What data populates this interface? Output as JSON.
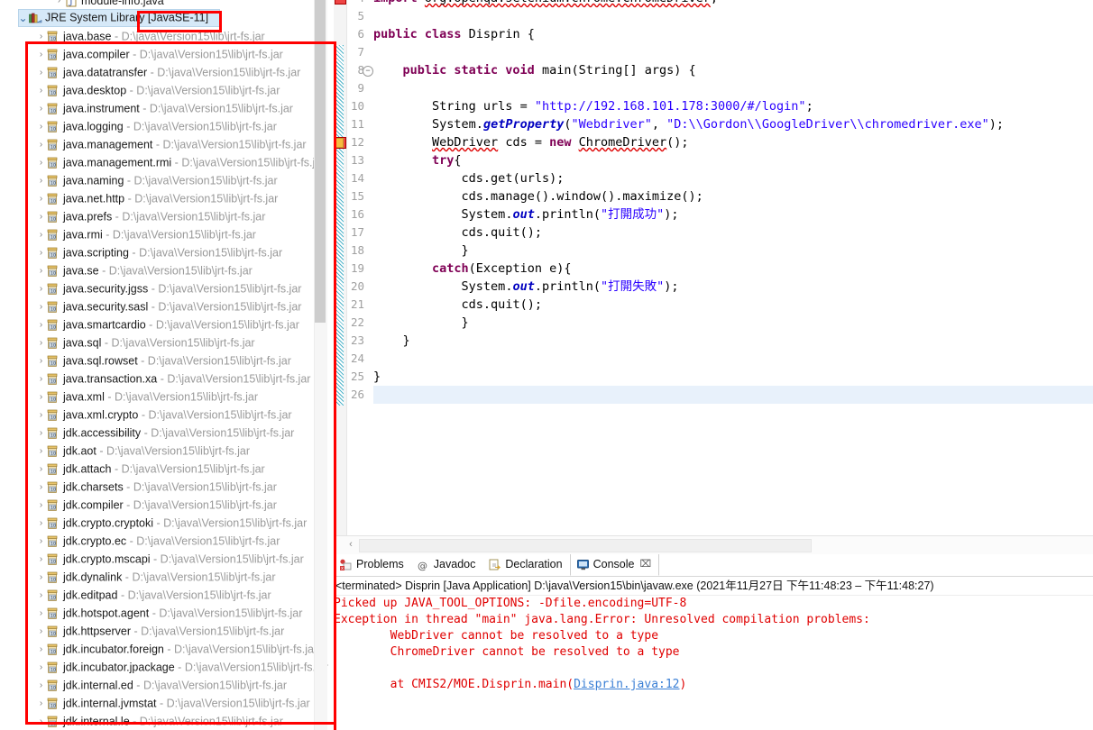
{
  "app": {
    "name": "Eclipse IDE",
    "accent_red": "#ff0000",
    "selection_blue": "#d6e9f8"
  },
  "sidebar": {
    "name": "package-explorer",
    "partial_top_item": {
      "label": "module-info.java",
      "icon": "java-file-icon",
      "arrow": "›"
    },
    "jre_node": {
      "label": "JRE System Library",
      "bracket": "[JavaSE-11]",
      "icon": "library-icon",
      "arrow": "⌄",
      "selected": true
    },
    "path_suffix": "D:\\java\\Version15\\lib\\jrt-fs.jar",
    "separator": "-",
    "modules": [
      "java.base",
      "java.compiler",
      "java.datatransfer",
      "java.desktop",
      "java.instrument",
      "java.logging",
      "java.management",
      "java.management.rmi",
      "java.naming",
      "java.net.http",
      "java.prefs",
      "java.rmi",
      "java.scripting",
      "java.se",
      "java.security.jgss",
      "java.security.sasl",
      "java.smartcardio",
      "java.sql",
      "java.sql.rowset",
      "java.transaction.xa",
      "java.xml",
      "java.xml.crypto",
      "jdk.accessibility",
      "jdk.aot",
      "jdk.attach",
      "jdk.charsets",
      "jdk.compiler",
      "jdk.crypto.cryptoki",
      "jdk.crypto.ec",
      "jdk.crypto.mscapi",
      "jdk.dynalink",
      "jdk.editpad",
      "jdk.hotspot.agent",
      "jdk.httpserver",
      "jdk.incubator.foreign",
      "jdk.incubator.jpackage",
      "jdk.internal.ed",
      "jdk.internal.jvmstat",
      "jdk.internal.le"
    ]
  },
  "editor": {
    "name": "java-source-editor",
    "first_visible_line": 4,
    "current_line": 26,
    "lines": [
      {
        "n": 4,
        "tokens": [
          {
            "t": "import ",
            "c": "kw"
          },
          {
            "t": "org.openqa.selenium.chrome.ChromeDriver",
            "c": "squig"
          },
          {
            "t": ";",
            "c": "plain"
          }
        ],
        "indent": 0,
        "marker": "error"
      },
      {
        "n": 5,
        "tokens": [],
        "indent": 0
      },
      {
        "n": 6,
        "tokens": [
          {
            "t": "public class ",
            "c": "kw"
          },
          {
            "t": "Disprin {",
            "c": "plain"
          }
        ],
        "indent": 0
      },
      {
        "n": 7,
        "tokens": [],
        "indent": 0
      },
      {
        "n": 8,
        "tokens": [
          {
            "t": "public static void ",
            "c": "kw"
          },
          {
            "t": "main(String[] args) {",
            "c": "plain"
          }
        ],
        "indent": 1,
        "fold": true
      },
      {
        "n": 9,
        "tokens": [],
        "indent": 0
      },
      {
        "n": 10,
        "tokens": [
          {
            "t": "String urls = ",
            "c": "plain"
          },
          {
            "t": "\"http://192.168.101.178:3000/#/login\"",
            "c": "str"
          },
          {
            "t": ";",
            "c": "plain"
          }
        ],
        "indent": 2
      },
      {
        "n": 11,
        "tokens": [
          {
            "t": "System.",
            "c": "plain"
          },
          {
            "t": "getProperty",
            "c": "ital"
          },
          {
            "t": "(",
            "c": "plain"
          },
          {
            "t": "\"Webdriver\"",
            "c": "str"
          },
          {
            "t": ", ",
            "c": "plain"
          },
          {
            "t": "\"D:\\\\Gordon\\\\GoogleDriver\\\\chromedriver.exe\"",
            "c": "str"
          },
          {
            "t": ");",
            "c": "plain"
          }
        ],
        "indent": 2
      },
      {
        "n": 12,
        "tokens": [
          {
            "t": "WebDriver",
            "c": "squig"
          },
          {
            "t": " cds = ",
            "c": "plain"
          },
          {
            "t": "new ",
            "c": "kw"
          },
          {
            "t": "ChromeDriver",
            "c": "squig"
          },
          {
            "t": "();",
            "c": "plain"
          }
        ],
        "indent": 2,
        "marker": "error"
      },
      {
        "n": 13,
        "tokens": [
          {
            "t": "try",
            "c": "kw"
          },
          {
            "t": "{",
            "c": "plain"
          }
        ],
        "indent": 2
      },
      {
        "n": 14,
        "tokens": [
          {
            "t": "cds.get(urls);",
            "c": "plain"
          }
        ],
        "indent": 3
      },
      {
        "n": 15,
        "tokens": [
          {
            "t": "cds.manage().window().maximize();",
            "c": "plain"
          }
        ],
        "indent": 3
      },
      {
        "n": 16,
        "tokens": [
          {
            "t": "System.",
            "c": "plain"
          },
          {
            "t": "out",
            "c": "ital"
          },
          {
            "t": ".println(",
            "c": "plain"
          },
          {
            "t": "\"打開成功\"",
            "c": "str"
          },
          {
            "t": ");",
            "c": "plain"
          }
        ],
        "indent": 3
      },
      {
        "n": 17,
        "tokens": [
          {
            "t": "cds.quit();",
            "c": "plain"
          }
        ],
        "indent": 3
      },
      {
        "n": 18,
        "tokens": [
          {
            "t": "}",
            "c": "plain"
          }
        ],
        "indent": 3
      },
      {
        "n": 19,
        "tokens": [
          {
            "t": "catch",
            "c": "kw"
          },
          {
            "t": "(Exception e){",
            "c": "plain"
          }
        ],
        "indent": 2
      },
      {
        "n": 20,
        "tokens": [
          {
            "t": "System.",
            "c": "plain"
          },
          {
            "t": "out",
            "c": "ital"
          },
          {
            "t": ".println(",
            "c": "plain"
          },
          {
            "t": "\"打開失敗\"",
            "c": "str"
          },
          {
            "t": ");",
            "c": "plain"
          }
        ],
        "indent": 3
      },
      {
        "n": 21,
        "tokens": [
          {
            "t": "cds.quit();",
            "c": "plain"
          }
        ],
        "indent": 3
      },
      {
        "n": 22,
        "tokens": [
          {
            "t": "}",
            "c": "plain"
          }
        ],
        "indent": 3
      },
      {
        "n": 23,
        "tokens": [
          {
            "t": "}",
            "c": "plain"
          }
        ],
        "indent": 1
      },
      {
        "n": 24,
        "tokens": [],
        "indent": 0
      },
      {
        "n": 25,
        "tokens": [
          {
            "t": "}",
            "c": "plain"
          }
        ],
        "indent": 0
      },
      {
        "n": 26,
        "tokens": [],
        "indent": 0
      }
    ],
    "scrollbar": {
      "left_arrow": "‹"
    }
  },
  "bottom_panel": {
    "name": "views-panel",
    "tabs": [
      {
        "label": "Problems",
        "icon": "problems-icon",
        "active": false,
        "closable": false
      },
      {
        "label": "Javadoc",
        "icon": "javadoc-icon",
        "active": false,
        "closable": false
      },
      {
        "label": "Declaration",
        "icon": "declaration-icon",
        "active": false,
        "closable": false
      },
      {
        "label": "Console",
        "icon": "console-icon",
        "active": true,
        "closable": true,
        "close_glyph": "⌧"
      }
    ],
    "console": {
      "header": "<terminated> Disprin [Java Application] D:\\java\\Version15\\bin\\javaw.exe  (2021年11月27日 下午11:48:23 – 下午11:48:27)",
      "lines": [
        {
          "text": "Picked up JAVA_TOOL_OPTIONS: -Dfile.encoding=UTF-8",
          "indent": 0
        },
        {
          "text": "Exception in thread \"main\" java.lang.Error: Unresolved compilation problems: ",
          "indent": 0
        },
        {
          "text": "WebDriver cannot be resolved to a type",
          "indent": 1
        },
        {
          "text": "ChromeDriver cannot be resolved to a type",
          "indent": 1
        },
        {
          "text": "",
          "indent": 0
        },
        {
          "text": "at CMIS2/MOE.Disprin.main(",
          "indent": 1,
          "link": "Disprin.java:12",
          "tail": ")"
        }
      ]
    }
  },
  "annotations": [
    {
      "name": "jre-version-highlight",
      "target": "[JavaSE-11]"
    },
    {
      "name": "modules-list-highlight",
      "target": "JRE module list"
    },
    {
      "name": "console-output-highlight",
      "target": "console output"
    }
  ]
}
